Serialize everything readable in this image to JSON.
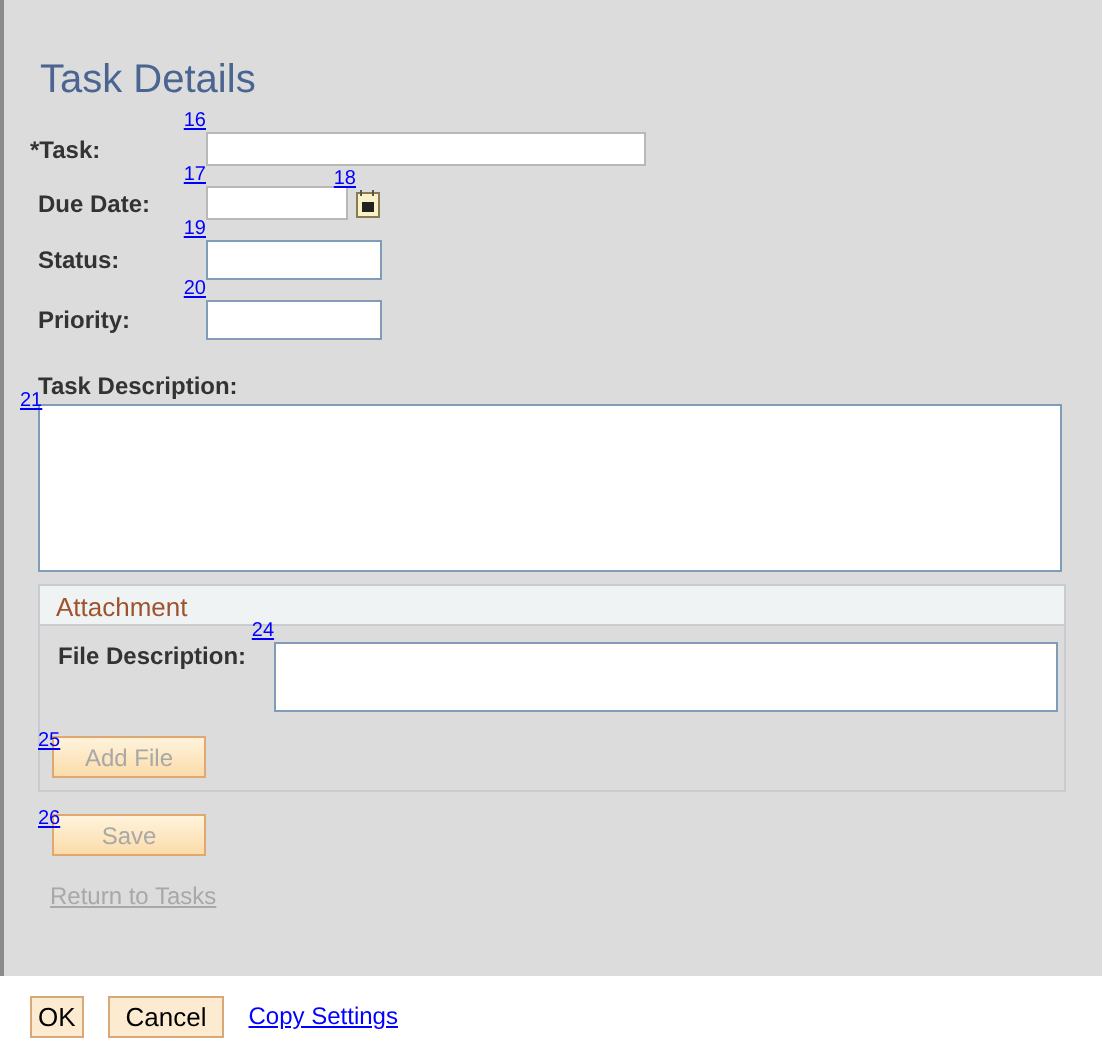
{
  "title": "Task Details",
  "fields": [
    {
      "label": "*Task:",
      "marker": "16",
      "kind": "text"
    },
    {
      "label": "Due Date:",
      "marker": "17",
      "kind": "date",
      "calendar_marker": "18"
    },
    {
      "label": "Status:",
      "marker": "19",
      "kind": "short"
    },
    {
      "label": "Priority:",
      "marker": "20",
      "kind": "short"
    }
  ],
  "description": {
    "label": "Task Description:",
    "marker": "21"
  },
  "attachment": {
    "title": "Attachment",
    "file_label": "File Description:",
    "file_marker": "24",
    "add_marker": "25",
    "add_button": {
      "label": "Add File",
      "disabled": true
    }
  },
  "save_marker": "26",
  "save_button": {
    "label": "Save",
    "disabled": true
  },
  "return_link": {
    "label": "Return to Tasks",
    "disabled": true
  },
  "footer": {
    "ok": "OK",
    "cancel": "Cancel",
    "copy": "Copy Settings"
  }
}
